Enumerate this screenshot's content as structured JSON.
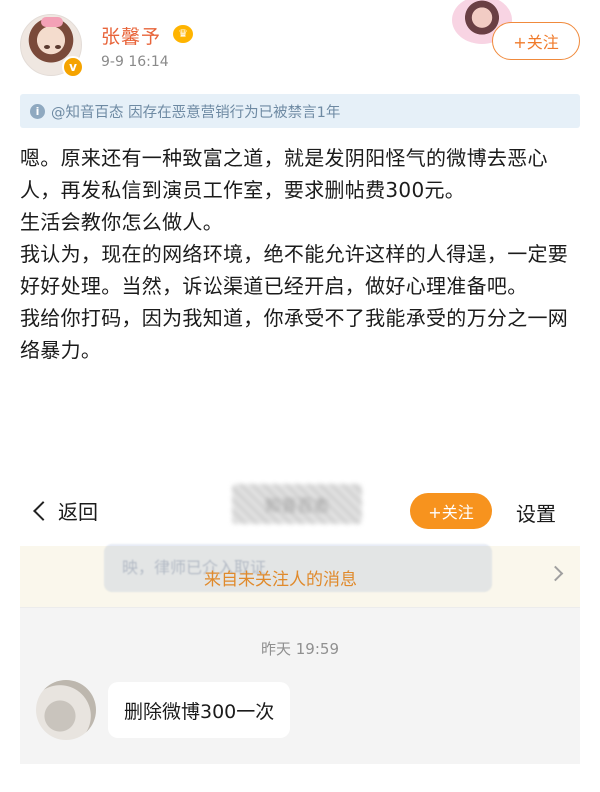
{
  "post": {
    "username": "张馨予",
    "crown_icon": "crown-badge-icon",
    "timestamp": "9-9 16:14",
    "follow_label": "+关注",
    "notice": "@知音百态 因存在恶意营销行为已被禁言1年",
    "paragraphs": [
      "嗯。原来还有一种致富之道，就是发阴阳怪气的微博去恶心人，再发私信到演员工作室，要求删帖费300元。",
      "生活会教你怎么做人。",
      "我认为，现在的网络环境，绝不能允许这样的人得逞，一定要好好处理。当然，诉讼渠道已经开启，做好心理准备吧。",
      "我给你打码，因为我知道，你承受不了我能承受的万分之一网络暴力。"
    ]
  },
  "screenshot": {
    "back_label": "返回",
    "blurred_name": "知音百态",
    "follow_label": "+关注",
    "settings_label": "设置",
    "ghost_toast": "映，律师已介入取证",
    "stranger_notice": "来自未关注人的消息",
    "message_time": "昨天 19:59",
    "message_text": "删除微博300一次"
  },
  "colors": {
    "username": "#e8643a",
    "follow_orange": "#f7931e",
    "notice_bg": "#e6f0f8",
    "notice_text": "#6e8aa3"
  }
}
